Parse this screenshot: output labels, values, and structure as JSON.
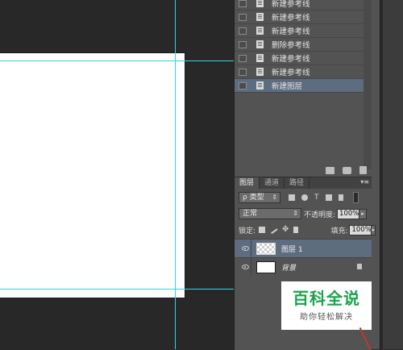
{
  "history": {
    "items": [
      {
        "label": "新建参考线",
        "active": false
      },
      {
        "label": "新建参考线",
        "active": false
      },
      {
        "label": "新建参考线",
        "active": false
      },
      {
        "label": "删除参考线",
        "active": false
      },
      {
        "label": "新建参考线",
        "active": false
      },
      {
        "label": "新建参考线",
        "active": false
      },
      {
        "label": "新建图层",
        "active": true
      }
    ],
    "footer_icons": [
      "new-document-from-state-icon",
      "snapshot-camera-icon",
      "trash-icon"
    ]
  },
  "layers_panel": {
    "tabs": [
      {
        "label": "图层",
        "active": true
      },
      {
        "label": "通道",
        "active": false
      },
      {
        "label": "路径",
        "active": false
      }
    ],
    "menu_glyph": "▾≡",
    "filter": {
      "prefix": "ρ",
      "value": "类型",
      "arrow": "⇕"
    },
    "blend_mode": {
      "value": "正常",
      "arrow": "⇕"
    },
    "opacity": {
      "label": "不透明度:",
      "value": "100%"
    },
    "lock_label": "锁定:",
    "fill": {
      "label": "填充:",
      "value": "100%"
    },
    "filter_icon_t": "T",
    "move_glyph": "✥",
    "layers": [
      {
        "name": "图层 1",
        "active": true,
        "thumb": "transparent",
        "locked": false
      },
      {
        "name": "背景",
        "active": false,
        "thumb": "white",
        "locked": true
      }
    ]
  },
  "watermark": {
    "title": "百科全说",
    "subtitle": "助你轻松解决",
    "title_color": "#1aa34a"
  },
  "colors": {
    "guide": "#31d4e4",
    "selected_row": "#5e6c80",
    "panel_bg": "#535353",
    "canvas_bg": "#282828"
  }
}
